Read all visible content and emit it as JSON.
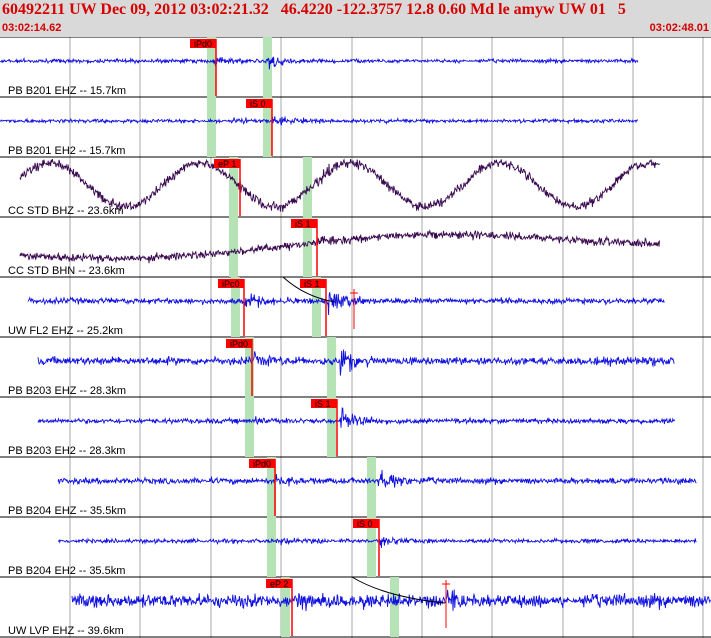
{
  "header": {
    "title": "60492211 UW Dec 09, 2012 03:02:21.32   46.4220 -122.3757 12.8 0.60 Md le amyw UW 01   5",
    "start_time": "03:02:14.62",
    "end_time": "03:02:48.01"
  },
  "colors": {
    "header_bg": "#d9d9d9",
    "header_text": "#d60000",
    "trace_blue": "#1010e0",
    "trace_purple": "#3a0a50",
    "pick_red": "#ff0000",
    "window_green": "#b6e3b6"
  },
  "traces": [
    {
      "label": "PB B201 EHZ -- 15.7km",
      "color_key": "trace_blue",
      "pick_label": "iPd0"
    },
    {
      "label": "PB B201 EH2 -- 15.7km",
      "color_key": "trace_blue",
      "pick_label": "iS 0"
    },
    {
      "label": "CC STD BHZ -- 23.6km",
      "color_key": "trace_purple",
      "pick_label": "eP 1"
    },
    {
      "label": "CC STD BHN -- 23.6km",
      "color_key": "trace_purple",
      "pick_label": "iS 1"
    },
    {
      "label": "UW FL2 EHZ -- 25.2km",
      "color_key": "trace_blue",
      "pick_label": "iPc0"
    },
    {
      "label": "PB B203 EHZ -- 28.3km",
      "color_key": "trace_blue",
      "pick_label": "iPd0"
    },
    {
      "label": "PB B203 EH2 -- 28.3km",
      "color_key": "trace_blue",
      "pick_label": "iS 1"
    },
    {
      "label": "PB B204 EHZ -- 35.5km",
      "color_key": "trace_blue",
      "pick_label": "iPd0"
    },
    {
      "label": "PB B204 EH2 -- 35.5km",
      "color_key": "trace_blue",
      "pick_label": "iS 0"
    },
    {
      "label": "UW LVP EHZ -- 39.6km",
      "color_key": "trace_blue",
      "pick_label": "eP 2"
    }
  ],
  "extra_picks": [
    {
      "trace": 4,
      "pick_label": "iS 1"
    }
  ]
}
